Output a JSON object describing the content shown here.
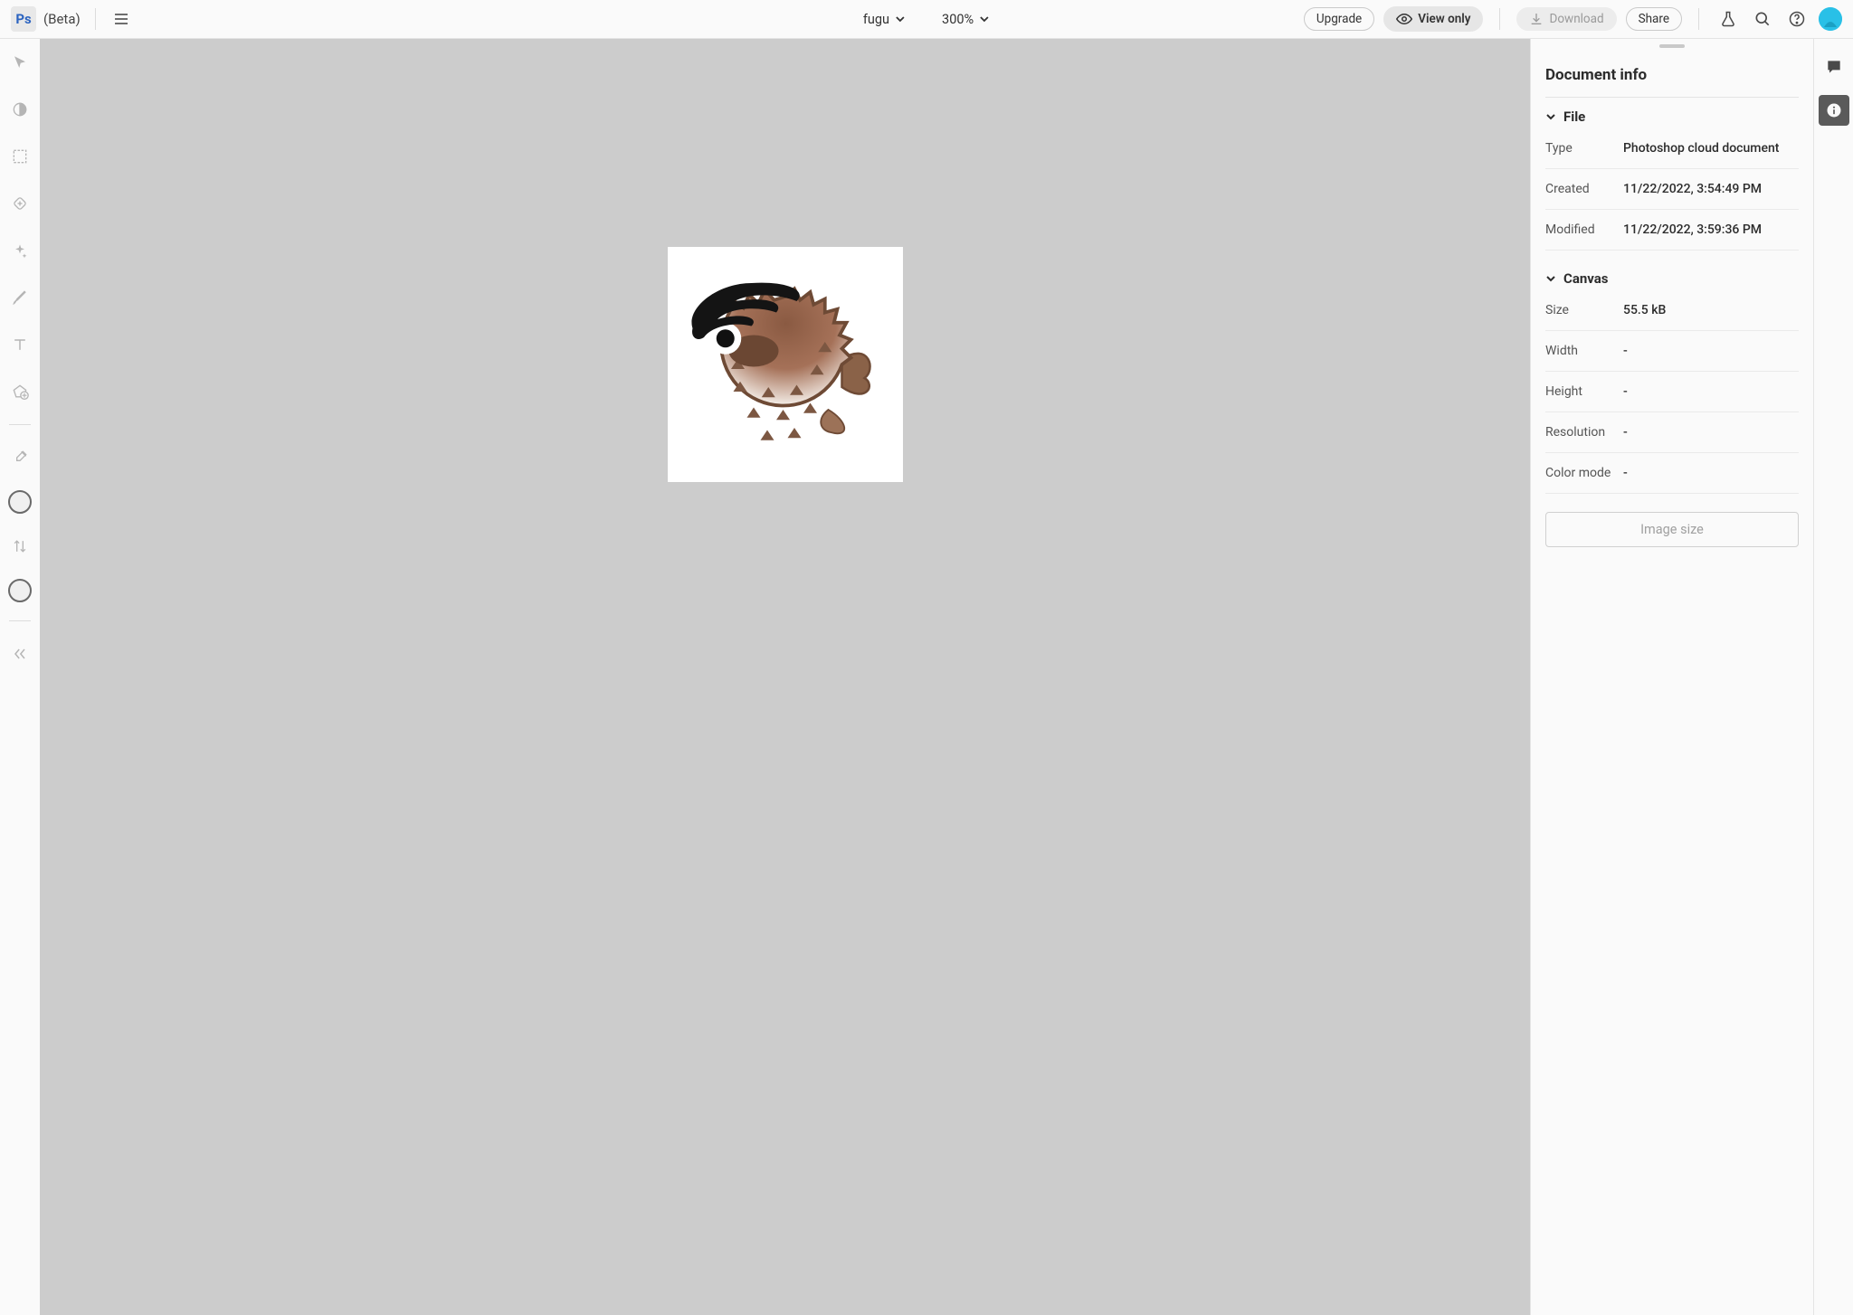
{
  "app": {
    "logo": "Ps",
    "tag": "(Beta)"
  },
  "doc": {
    "name": "fugu",
    "zoom": "300%"
  },
  "header": {
    "upgrade": "Upgrade",
    "viewonly": "View only",
    "download": "Download",
    "share": "Share"
  },
  "panel": {
    "title": "Document info",
    "sections": {
      "file": {
        "label": "File",
        "rows": {
          "type": {
            "label": "Type",
            "value": "Photoshop cloud document"
          },
          "created": {
            "label": "Created",
            "value": "11/22/2022, 3:54:49 PM"
          },
          "modified": {
            "label": "Modified",
            "value": "11/22/2022, 3:59:36 PM"
          }
        }
      },
      "canvas": {
        "label": "Canvas",
        "rows": {
          "size": {
            "label": "Size",
            "value": "55.5 kB"
          },
          "width": {
            "label": "Width",
            "value": "-"
          },
          "height": {
            "label": "Height",
            "value": "-"
          },
          "resolution": {
            "label": "Resolution",
            "value": "-"
          },
          "colormode": {
            "label": "Color mode",
            "value": "-"
          }
        }
      }
    },
    "image_size_btn": "Image size"
  }
}
